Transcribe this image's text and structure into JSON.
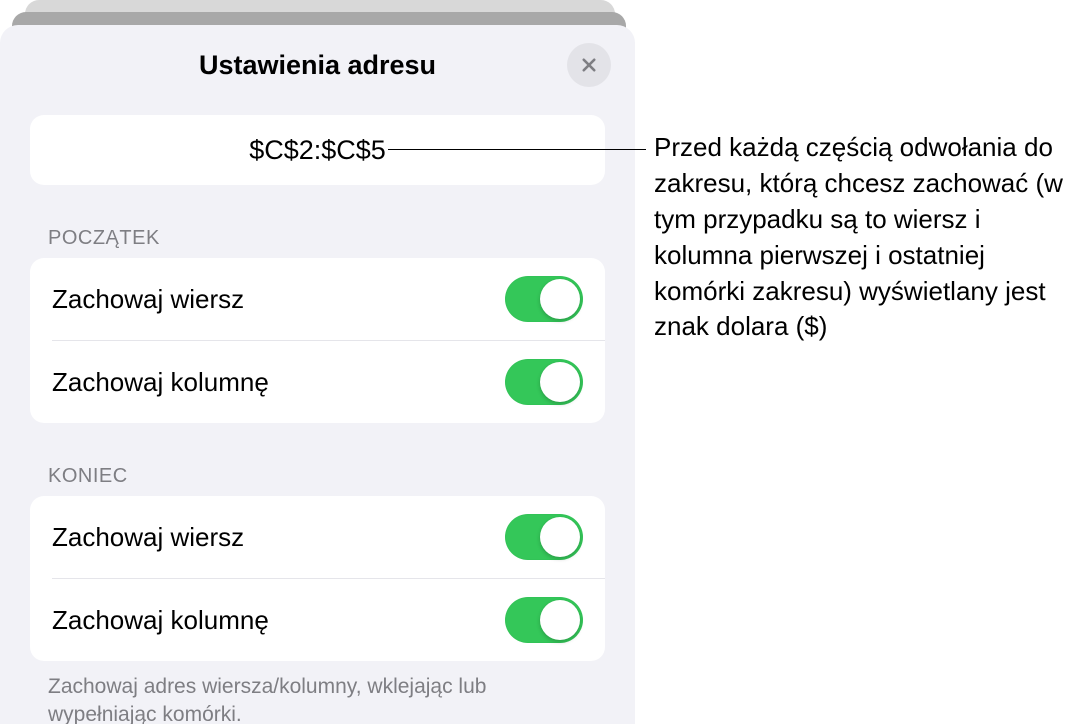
{
  "modal": {
    "title": "Ustawienia adresu",
    "address": "$C$2:$C$5",
    "sections": [
      {
        "header": "POCZĄTEK",
        "rows": [
          {
            "label": "Zachowaj wiersz",
            "on": true
          },
          {
            "label": "Zachowaj kolumnę",
            "on": true
          }
        ]
      },
      {
        "header": "KONIEC",
        "rows": [
          {
            "label": "Zachowaj wiersz",
            "on": true
          },
          {
            "label": "Zachowaj kolumnę",
            "on": true
          }
        ]
      }
    ],
    "footer": "Zachowaj adres wiersza/kolumny, wklejając lub wypełniając komórki."
  },
  "callout": "Przed każdą częścią odwołania do zakresu, którą chcesz zachować (w tym przypadku są to wiersz i kolumna pierwszej i ostatniej komórki zakresu) wyświetlany jest znak dolara ($)"
}
